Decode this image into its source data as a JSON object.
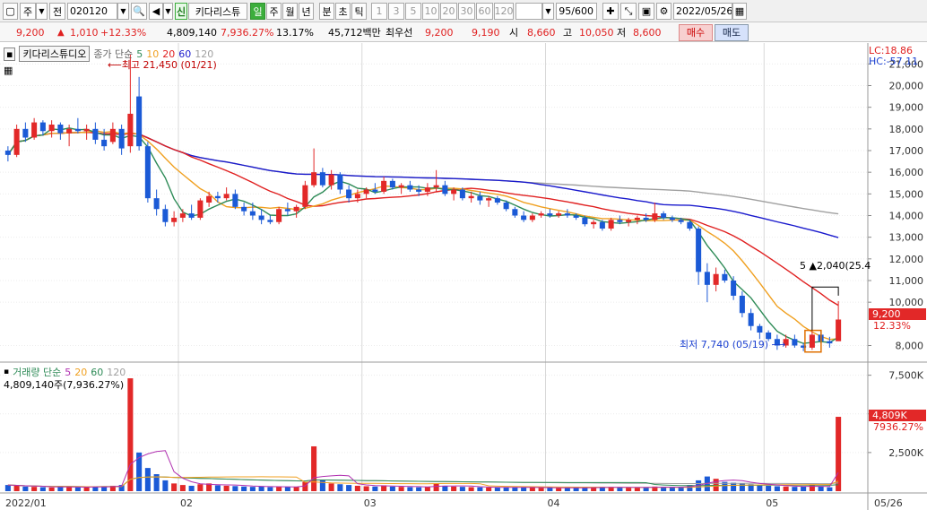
{
  "toolbar": {
    "type_selector": "주",
    "prefix": "전",
    "code": "020120",
    "sin_badge": "신",
    "stock_name": "키다리스튜",
    "periods": [
      "일",
      "주",
      "월",
      "년",
      "분",
      "초",
      "틱"
    ],
    "minutes": [
      "1",
      "3",
      "5",
      "10",
      "20",
      "30",
      "60",
      "120"
    ],
    "count": "95/600",
    "date": "2022/05/26"
  },
  "price_info": {
    "price": "9,200",
    "change": "1,010",
    "change_pct": "+12.33%",
    "volume": "4,809,140",
    "volume_ratio": "7,936.27%",
    "turnover": "13.17%",
    "amount": "45,712백만",
    "best_bid_label": "최우선",
    "best_ask": "9,200",
    "best_bid": "9,190",
    "open_label": "시",
    "open": "8,660",
    "high_label": "고",
    "high": "10,050",
    "low_label": "저",
    "low": "8,600",
    "buy_label": "매수",
    "sell_label": "매도"
  },
  "price_panel": {
    "title": "키다리스튜디오",
    "ma_label": "종가 단순",
    "ma_periods": [
      "5",
      "10",
      "20",
      "60",
      "120"
    ],
    "lc_text": "LC:18.86",
    "hc_text": "HC:-57.11",
    "high_annotation": "최고 21,450 (01/21)",
    "low_annotation": "최저 7,740 (05/19)",
    "recent_annotation": "5 ▲2,040(25.4",
    "current_price_tag": "9,200",
    "current_pct_tag": "12.33%"
  },
  "volume_panel": {
    "title": "거래량 단순",
    "ma_periods": [
      "5",
      "20",
      "60",
      "120"
    ],
    "value_text": "4,809,140주(7,936.27%)",
    "current_tag": "4,809K",
    "current_pct_tag": "7936.27%"
  },
  "x_labels": [
    "2022/01",
    "02",
    "03",
    "04",
    "05",
    "05/26"
  ],
  "colors": {
    "up": "#e22828",
    "down": "#1b5ad6",
    "ma5": "#2e8b57",
    "ma10": "#f0a020",
    "ma20": "#e02020",
    "ma60": "#1a1acd",
    "ma120": "#a0a0a0"
  },
  "chart_data": {
    "type": "candlestick",
    "y_axis_price": [
      21000,
      20000,
      19000,
      18000,
      17000,
      16000,
      15000,
      14000,
      13000,
      12000,
      11000,
      10000,
      8000
    ],
    "y_axis_volume": [
      "7,500K",
      "5,000K",
      "2,500K"
    ],
    "ylim_price": [
      7400,
      21800
    ],
    "ylim_volume": [
      0,
      8000
    ],
    "candles": [
      [
        17000,
        17200,
        16500,
        16800,
        400
      ],
      [
        16800,
        18200,
        16700,
        18000,
        350
      ],
      [
        18000,
        18300,
        17400,
        17600,
        300
      ],
      [
        17600,
        18500,
        17500,
        18300,
        280
      ],
      [
        18300,
        18400,
        17700,
        17900,
        260
      ],
      [
        17900,
        18400,
        17600,
        18200,
        240
      ],
      [
        18200,
        18300,
        17500,
        17800,
        300
      ],
      [
        17800,
        18200,
        17200,
        18000,
        280
      ],
      [
        18000,
        18500,
        17800,
        17900,
        250
      ],
      [
        17900,
        18200,
        17500,
        18000,
        240
      ],
      [
        18000,
        18300,
        17300,
        17500,
        300
      ],
      [
        17500,
        18000,
        17000,
        17200,
        320
      ],
      [
        17400,
        18300,
        17300,
        18000,
        350
      ],
      [
        18000,
        18200,
        16800,
        17100,
        400
      ],
      [
        17200,
        21450,
        16900,
        18700,
        7300
      ],
      [
        19500,
        20400,
        17000,
        17200,
        2500
      ],
      [
        17200,
        17400,
        14600,
        14800,
        1500
      ],
      [
        14800,
        15200,
        14000,
        14300,
        1100
      ],
      [
        14300,
        14500,
        13500,
        13700,
        700
      ],
      [
        13700,
        14200,
        13500,
        13900,
        500
      ],
      [
        13900,
        14300,
        13700,
        14100,
        400
      ],
      [
        14100,
        14500,
        13800,
        13900,
        350
      ],
      [
        13900,
        14800,
        13800,
        14700,
        450
      ],
      [
        14600,
        15100,
        14400,
        14900,
        500
      ],
      [
        14900,
        15100,
        14600,
        14800,
        380
      ],
      [
        14800,
        15300,
        14700,
        15000,
        350
      ],
      [
        15000,
        15200,
        14300,
        14400,
        330
      ],
      [
        14400,
        14600,
        14000,
        14200,
        300
      ],
      [
        14200,
        14600,
        13800,
        14000,
        280
      ],
      [
        14000,
        14300,
        13600,
        13800,
        300
      ],
      [
        13800,
        14000,
        13600,
        13700,
        260
      ],
      [
        13700,
        14400,
        13600,
        14300,
        300
      ],
      [
        14300,
        14600,
        14000,
        14200,
        280
      ],
      [
        14200,
        14500,
        13900,
        14400,
        260
      ],
      [
        14400,
        15600,
        14300,
        15400,
        600
      ],
      [
        15400,
        17100,
        15300,
        16000,
        2900
      ],
      [
        16000,
        16200,
        15300,
        15400,
        700
      ],
      [
        15400,
        16100,
        15200,
        15900,
        500
      ],
      [
        15900,
        16000,
        15000,
        15200,
        450
      ],
      [
        15200,
        15400,
        14600,
        14800,
        400
      ],
      [
        14800,
        15200,
        14600,
        15000,
        350
      ],
      [
        15000,
        15300,
        14800,
        15200,
        320
      ],
      [
        15200,
        15500,
        15000,
        15100,
        300
      ],
      [
        15100,
        15800,
        15000,
        15600,
        380
      ],
      [
        15600,
        15700,
        15200,
        15300,
        300
      ],
      [
        15300,
        15500,
        15000,
        15400,
        280
      ],
      [
        15400,
        15600,
        15100,
        15200,
        260
      ],
      [
        15200,
        15400,
        14900,
        15100,
        250
      ],
      [
        15100,
        15500,
        14900,
        15300,
        280
      ],
      [
        15300,
        16100,
        15100,
        15400,
        500
      ],
      [
        15400,
        15600,
        14900,
        15000,
        350
      ],
      [
        15000,
        15300,
        14700,
        15200,
        300
      ],
      [
        15200,
        15300,
        14700,
        14800,
        280
      ],
      [
        14800,
        15100,
        14600,
        14900,
        260
      ],
      [
        14900,
        15100,
        14500,
        14700,
        250
      ],
      [
        14700,
        14900,
        14400,
        14800,
        240
      ],
      [
        14800,
        14900,
        14500,
        14600,
        230
      ],
      [
        14600,
        14700,
        14200,
        14300,
        240
      ],
      [
        14300,
        14400,
        13900,
        14000,
        260
      ],
      [
        14000,
        14200,
        13700,
        13800,
        250
      ],
      [
        13800,
        14100,
        13700,
        14000,
        230
      ],
      [
        14000,
        14200,
        13900,
        14100,
        220
      ],
      [
        14100,
        14300,
        13900,
        14000,
        210
      ],
      [
        14000,
        14200,
        13900,
        14100,
        200
      ],
      [
        14100,
        14300,
        13900,
        14000,
        210
      ],
      [
        14000,
        14100,
        13800,
        13900,
        230
      ],
      [
        13900,
        14000,
        13500,
        13600,
        260
      ],
      [
        13600,
        13800,
        13400,
        13700,
        240
      ],
      [
        13700,
        13800,
        13300,
        13400,
        250
      ],
      [
        13400,
        13900,
        13300,
        13800,
        280
      ],
      [
        13800,
        14000,
        13600,
        13700,
        250
      ],
      [
        13700,
        13900,
        13500,
        13800,
        230
      ],
      [
        13800,
        14000,
        13600,
        13900,
        240
      ],
      [
        13900,
        14100,
        13700,
        13800,
        260
      ],
      [
        13800,
        14600,
        13700,
        14100,
        300
      ],
      [
        14100,
        14200,
        13800,
        13900,
        260
      ],
      [
        13900,
        14000,
        13700,
        13800,
        240
      ],
      [
        13800,
        13900,
        13600,
        13700,
        250
      ],
      [
        13700,
        13800,
        13300,
        13400,
        400
      ],
      [
        13400,
        13500,
        10800,
        11400,
        700
      ],
      [
        11400,
        11800,
        10000,
        10800,
        950
      ],
      [
        10800,
        11600,
        10500,
        11300,
        800
      ],
      [
        11300,
        11500,
        10900,
        11000,
        600
      ],
      [
        11000,
        11200,
        10100,
        10300,
        550
      ],
      [
        10300,
        10500,
        9300,
        9500,
        500
      ],
      [
        9500,
        9700,
        8700,
        8900,
        450
      ],
      [
        8900,
        9000,
        8300,
        8600,
        400
      ],
      [
        8600,
        8700,
        8200,
        8300,
        350
      ],
      [
        8300,
        8500,
        7800,
        8000,
        320
      ],
      [
        8000,
        8500,
        7900,
        8300,
        300
      ],
      [
        8300,
        8500,
        7900,
        8000,
        280
      ],
      [
        8000,
        8100,
        7740,
        7900,
        300
      ],
      [
        7900,
        8700,
        7800,
        8500,
        380
      ],
      [
        8500,
        8700,
        8100,
        8200,
        300
      ],
      [
        8200,
        8400,
        7900,
        8100,
        250
      ],
      [
        8200,
        10050,
        8600,
        9200,
        4809
      ]
    ]
  }
}
